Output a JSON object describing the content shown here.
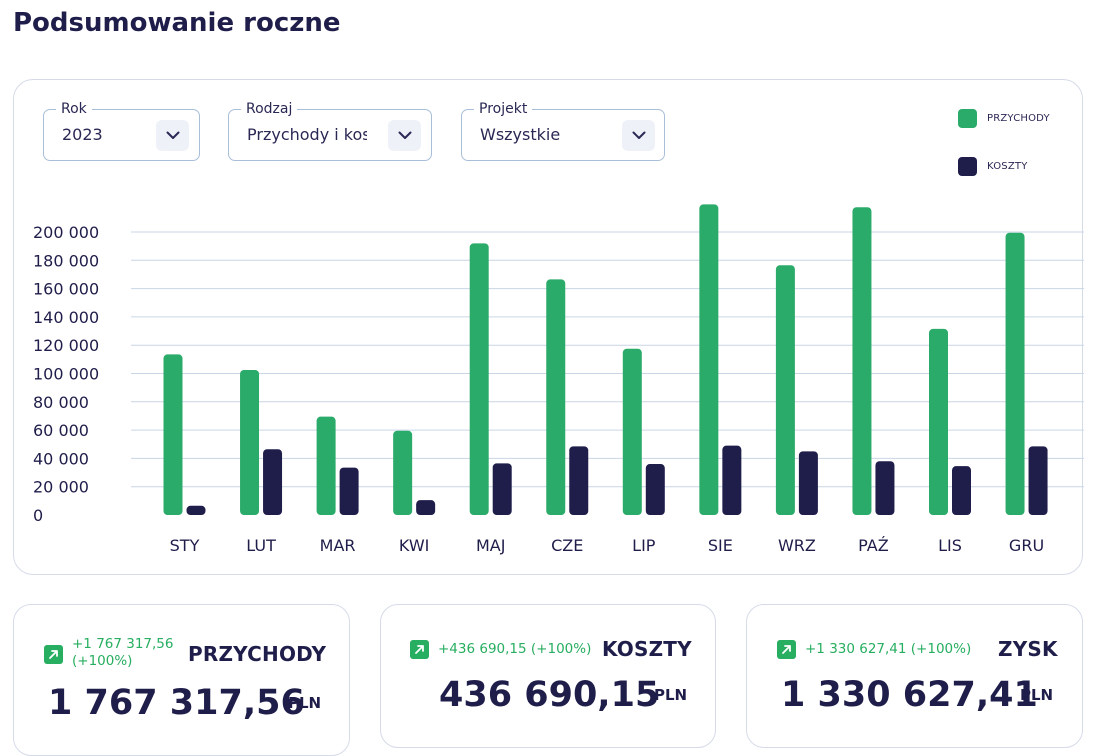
{
  "page": {
    "title": "Podsumowanie roczne"
  },
  "filters": {
    "year": {
      "label": "Rok",
      "value": "2023"
    },
    "type": {
      "label": "Rodzaj",
      "value": "Przychody i koszty"
    },
    "project": {
      "label": "Projekt",
      "value": "Wszystkie"
    }
  },
  "icons": {
    "dropdown": "chevron-down-icon",
    "trend": "arrow-up-right-icon"
  },
  "colors": {
    "revenue": "#2bab69",
    "costs": "#1f1d4a",
    "accent": "#27ae60",
    "text": "#1f1d4a",
    "grid": "#c9d6e6"
  },
  "chart_data": {
    "type": "bar",
    "categories": [
      "STY",
      "LUT",
      "MAR",
      "KWI",
      "MAJ",
      "CZE",
      "LIP",
      "SIE",
      "WRZ",
      "PAŹ",
      "LIS",
      "GRU"
    ],
    "series": [
      {
        "name": "PRZYCHODY",
        "values": [
          113500,
          102500,
          69500,
          59500,
          192000,
          166500,
          117500,
          219500,
          176500,
          217500,
          131500,
          199500
        ]
      },
      {
        "name": "KOSZTY",
        "values": [
          6500,
          46500,
          33500,
          10500,
          36500,
          48500,
          36000,
          49000,
          45000,
          38000,
          34500,
          48500
        ]
      }
    ],
    "y_ticks": [
      "0",
      "20 000",
      "40 000",
      "60 000",
      "80 000",
      "100 000",
      "120 000",
      "140 000",
      "160 000",
      "180 000",
      "200 000"
    ],
    "ylim": [
      0,
      220000
    ],
    "grid": true,
    "legend_position": "top-right"
  },
  "summary": [
    {
      "title": "PRZYCHODY",
      "delta": "+1 767 317,56 (+100%)",
      "value": "1 767 317,56",
      "unit": "PLN"
    },
    {
      "title": "KOSZTY",
      "delta": "+436 690,15 (+100%)",
      "value": "436 690,15",
      "unit": "PLN"
    },
    {
      "title": "ZYSK",
      "delta": "+1 330 627,41 (+100%)",
      "value": "1 330 627,41",
      "unit": "PLN"
    }
  ]
}
